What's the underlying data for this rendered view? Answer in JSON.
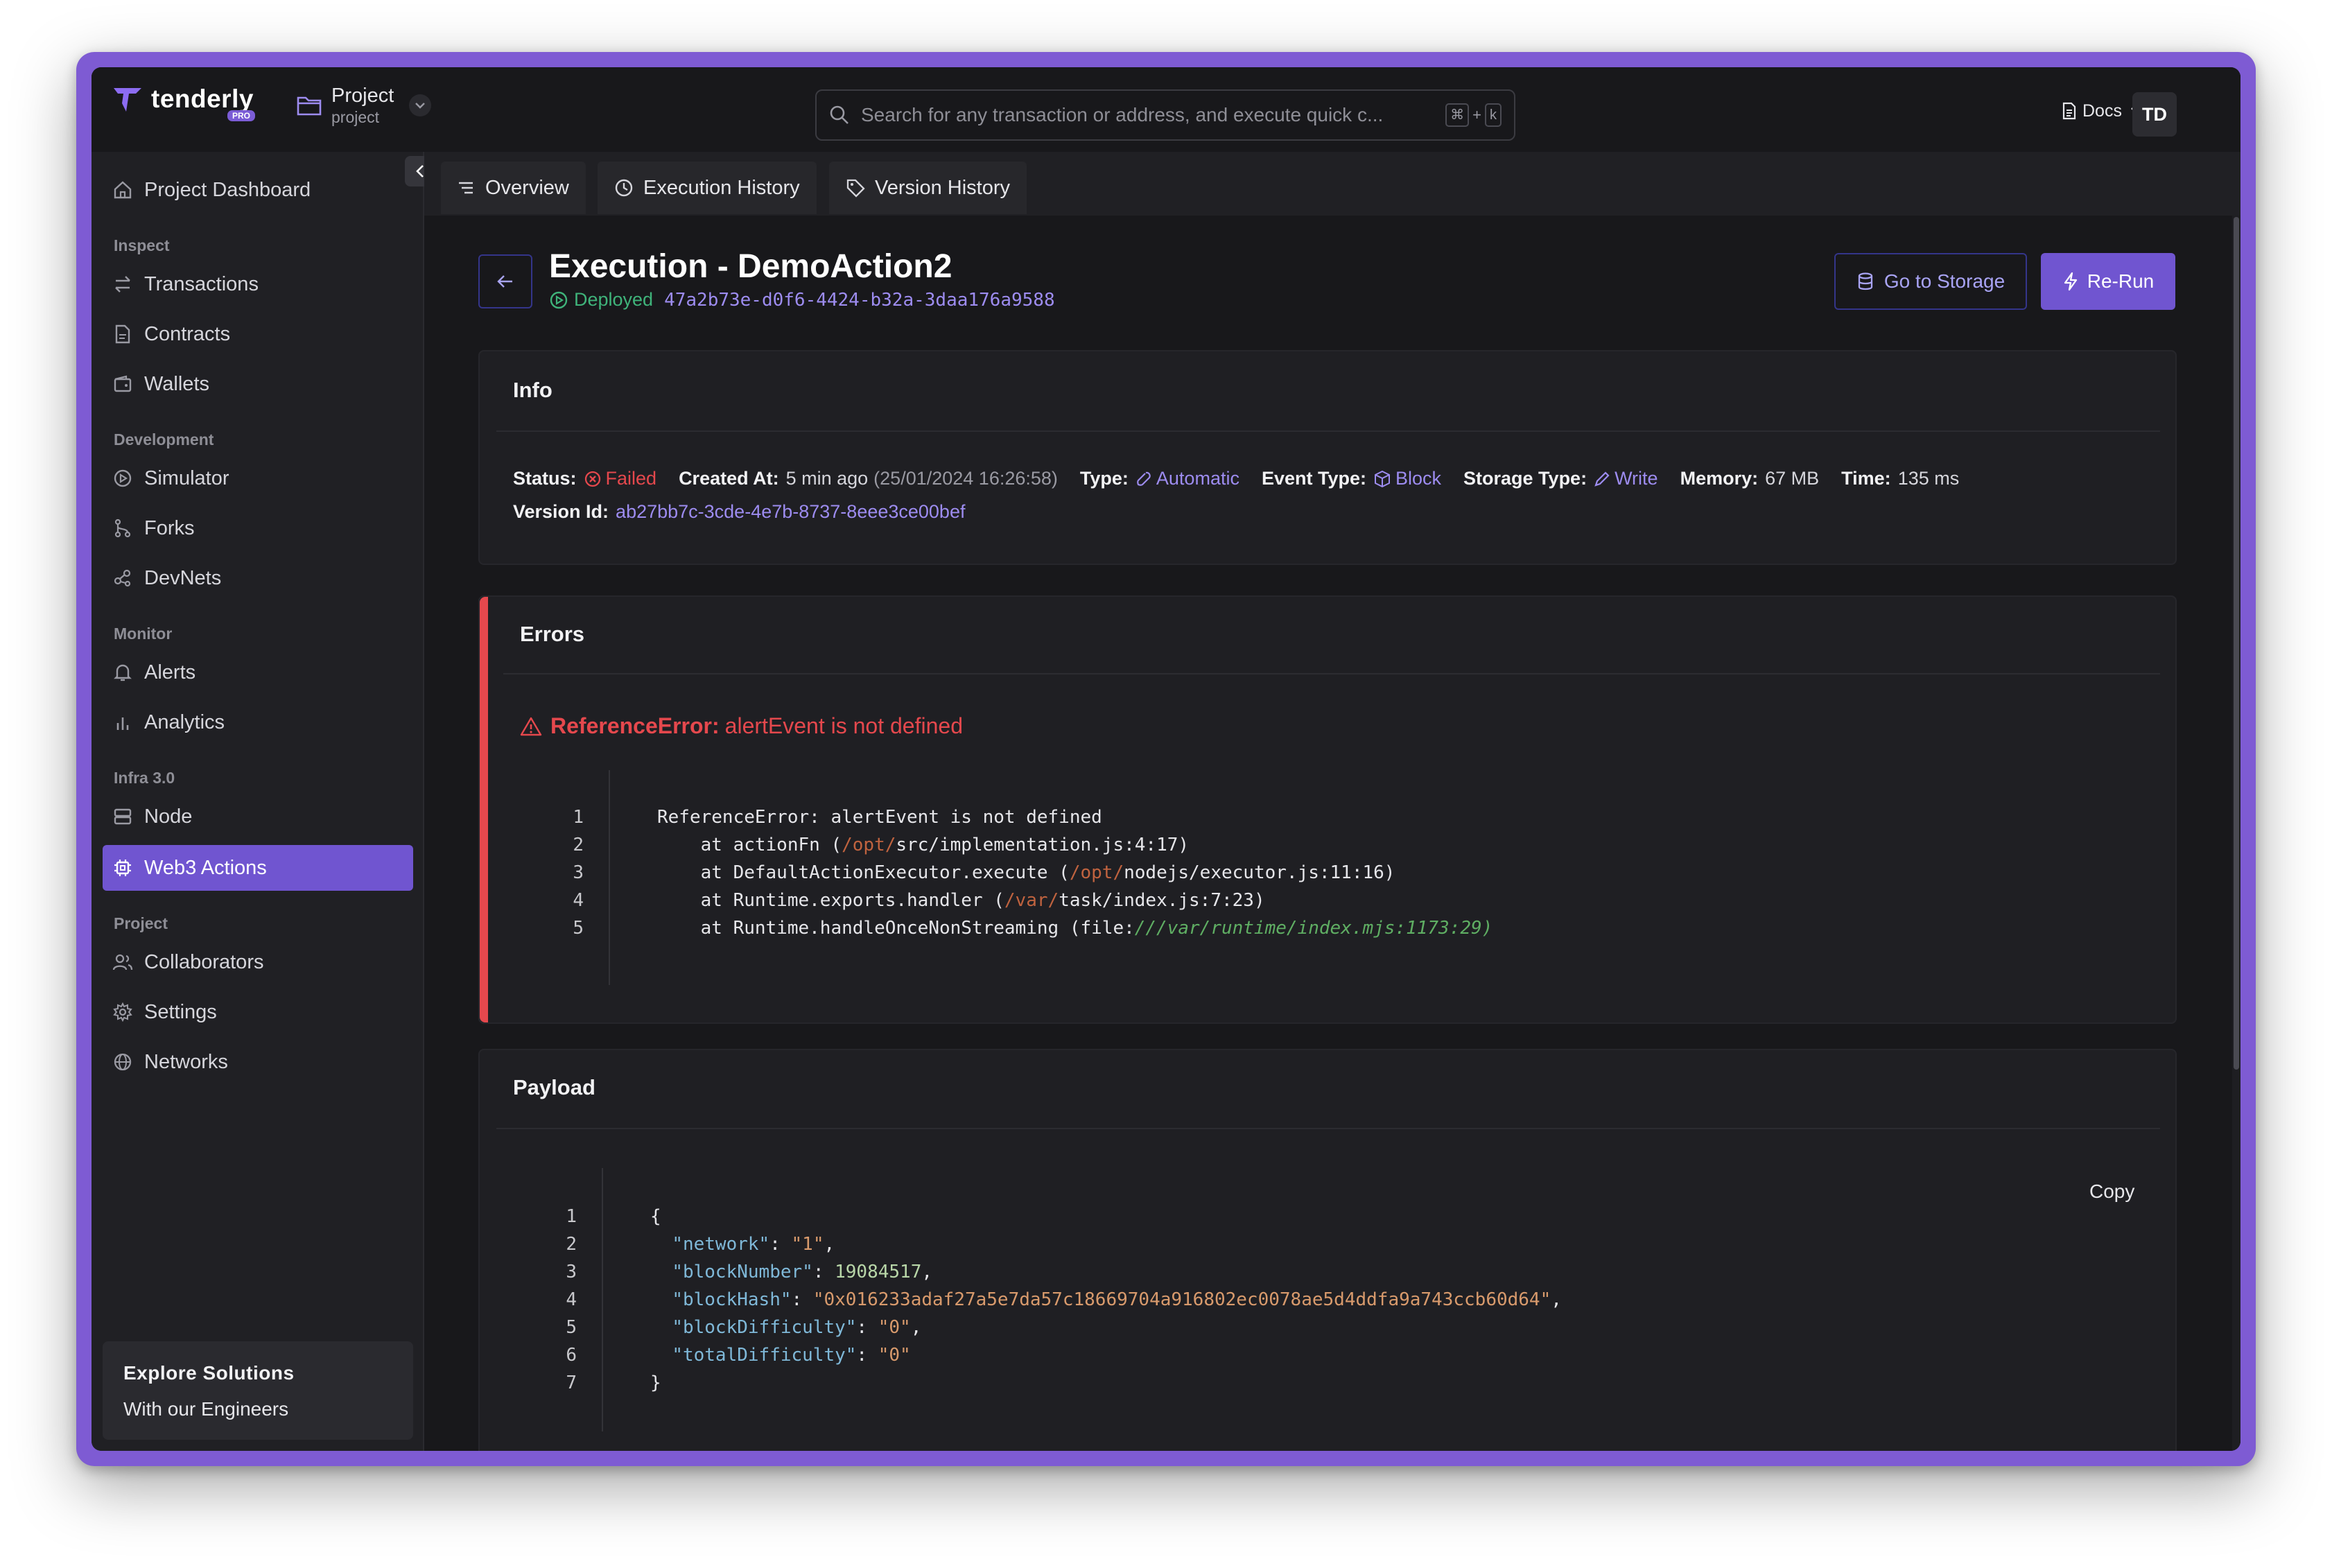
{
  "brand": {
    "name": "tenderly",
    "badge": "PRO"
  },
  "project": {
    "name": "Project",
    "slug": "project"
  },
  "search": {
    "placeholder": "Search for any transaction or address, and execute quick c...",
    "kbd1": "⌘",
    "kbd_plus": "+",
    "kbd2": "k"
  },
  "header": {
    "docs": "Docs",
    "avatar": "TD"
  },
  "sidebar": {
    "dashboard": "Project Dashboard",
    "sections": [
      {
        "title": "Inspect",
        "items": [
          "Transactions",
          "Contracts",
          "Wallets"
        ]
      },
      {
        "title": "Development",
        "items": [
          "Simulator",
          "Forks",
          "DevNets"
        ]
      },
      {
        "title": "Monitor",
        "items": [
          "Alerts",
          "Analytics"
        ]
      },
      {
        "title": "Infra 3.0",
        "items": [
          "Node",
          "Web3 Actions"
        ]
      },
      {
        "title": "Project",
        "items": [
          "Collaborators",
          "Settings",
          "Networks"
        ]
      }
    ],
    "active": "Web3 Actions",
    "explore": {
      "title": "Explore Solutions",
      "subtitle": "With our Engineers"
    }
  },
  "tabs": [
    "Overview",
    "Execution History",
    "Version History"
  ],
  "execution": {
    "title": "Execution - DemoAction2",
    "status": "Deployed",
    "id": "47a2b73e-d0f6-4424-b32a-3daa176a9588",
    "go_to_storage": "Go to Storage",
    "rerun": "Re-Run"
  },
  "info": {
    "title": "Info",
    "status_label": "Status:",
    "status_value": "Failed",
    "created_label": "Created At:",
    "created_value": "5 min ago",
    "created_full": "(25/01/2024 16:26:58)",
    "type_label": "Type:",
    "type_value": "Automatic",
    "event_label": "Event Type:",
    "event_value": "Block",
    "storage_label": "Storage Type:",
    "storage_value": "Write",
    "memory_label": "Memory:",
    "memory_value": "67 MB",
    "time_label": "Time:",
    "time_value": "135 ms",
    "version_label": "Version Id:",
    "version_value": "ab27bb7c-3cde-4e7b-8737-8eee3ce00bef"
  },
  "errors": {
    "title": "Errors",
    "error_type": "ReferenceError:",
    "error_message": "alertEvent is not defined",
    "trace": [
      "1",
      "2",
      "3",
      "4",
      "5"
    ],
    "lines": {
      "l1": "ReferenceError: alertEvent is not defined",
      "l2_a": "    at actionFn (",
      "l2_b": "/opt/",
      "l2_c": "src/implementation.js:4:17)",
      "l3_a": "    at DefaultActionExecutor.execute (",
      "l3_b": "/opt/",
      "l3_c": "nodejs/executor.js:11:16)",
      "l4_a": "    at Runtime.exports.handler (",
      "l4_b": "/var/",
      "l4_c": "task/index.js:7:23)",
      "l5_a": "    at Runtime.handleOnceNonStreaming (file:",
      "l5_b": "///var/runtime/index.mjs:1173:29)"
    }
  },
  "payload": {
    "title": "Payload",
    "copy": "Copy",
    "line_numbers": [
      "1",
      "2",
      "3",
      "4",
      "5",
      "6",
      "7"
    ],
    "open": "{",
    "close": "}",
    "fields": [
      {
        "key": "\"network\"",
        "value": "\"1\"",
        "kind": "str",
        "trail": ","
      },
      {
        "key": "\"blockNumber\"",
        "value": "19084517",
        "kind": "num",
        "trail": ","
      },
      {
        "key": "\"blockHash\"",
        "value": "\"0x016233adaf27a5e7da57c18669704a916802ec0078ae5d4ddfa9a743ccb60d64\"",
        "kind": "str",
        "trail": ","
      },
      {
        "key": "\"blockDifficulty\"",
        "value": "\"0\"",
        "kind": "str",
        "trail": ","
      },
      {
        "key": "\"totalDifficulty\"",
        "value": "\"0\"",
        "kind": "str",
        "trail": ""
      }
    ]
  },
  "colors": {
    "accent": "#7055d0",
    "frame": "#7e5bd3",
    "error": "#e5484d",
    "success": "#3fb37a",
    "link": "#9d8cf0"
  }
}
